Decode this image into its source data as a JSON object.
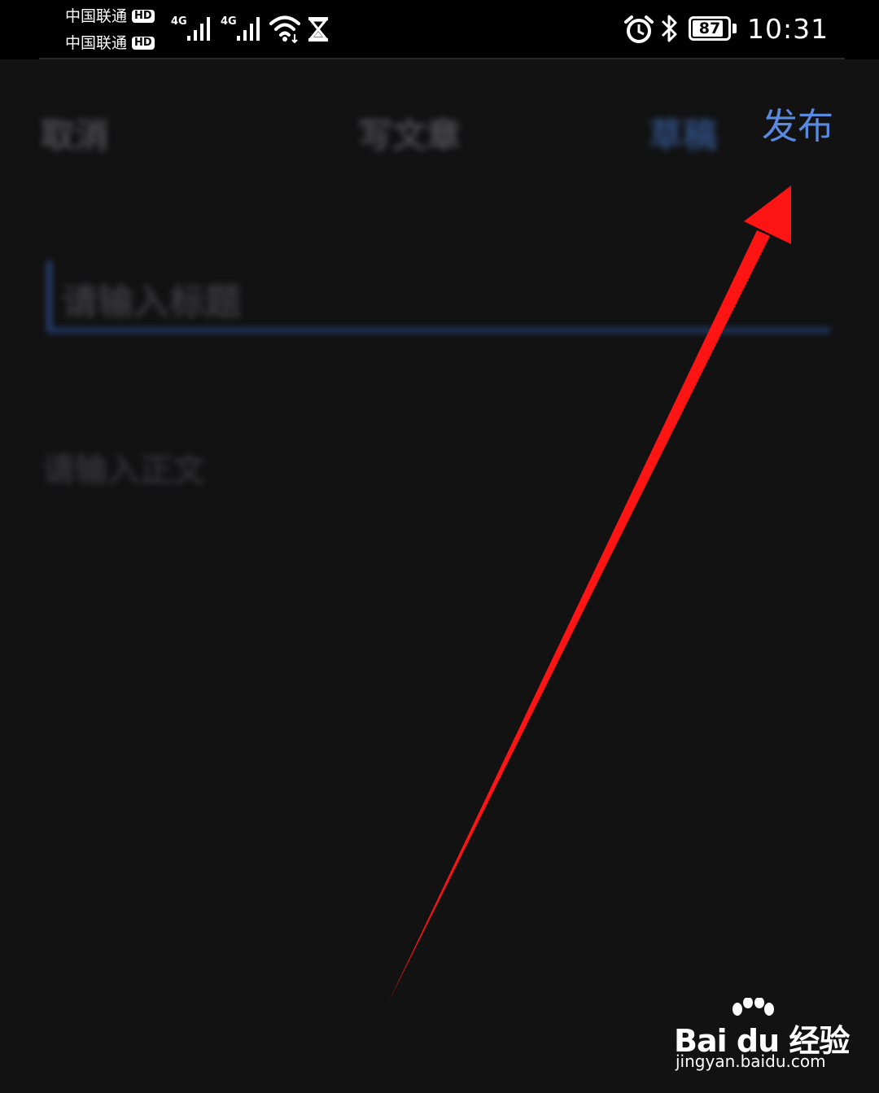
{
  "status_bar": {
    "carrier_1": "中国联通",
    "carrier_2": "中国联通",
    "hd_badge": "HD",
    "network_1": "4G",
    "network_2": "4G",
    "battery_level": "87",
    "battery_fraction": 0.87,
    "time": "10:31",
    "icons": [
      "signal-icon",
      "wifi-icon",
      "hourglass-icon",
      "alarm-icon",
      "bluetooth-icon",
      "battery-icon"
    ]
  },
  "header": {
    "cancel_label": "取消",
    "title": "写文章",
    "draft_label": "草稿",
    "publish_label": "发布"
  },
  "editor": {
    "title_placeholder": "请输入标题",
    "body_placeholder": "请输入正文"
  },
  "annotation": {
    "arrow_color": "#ff1414"
  },
  "watermark": {
    "logo": "Bai du 经验",
    "url": "jingyan.baidu.com"
  },
  "colors": {
    "accent": "#5a8ae0",
    "background": "#121213"
  }
}
